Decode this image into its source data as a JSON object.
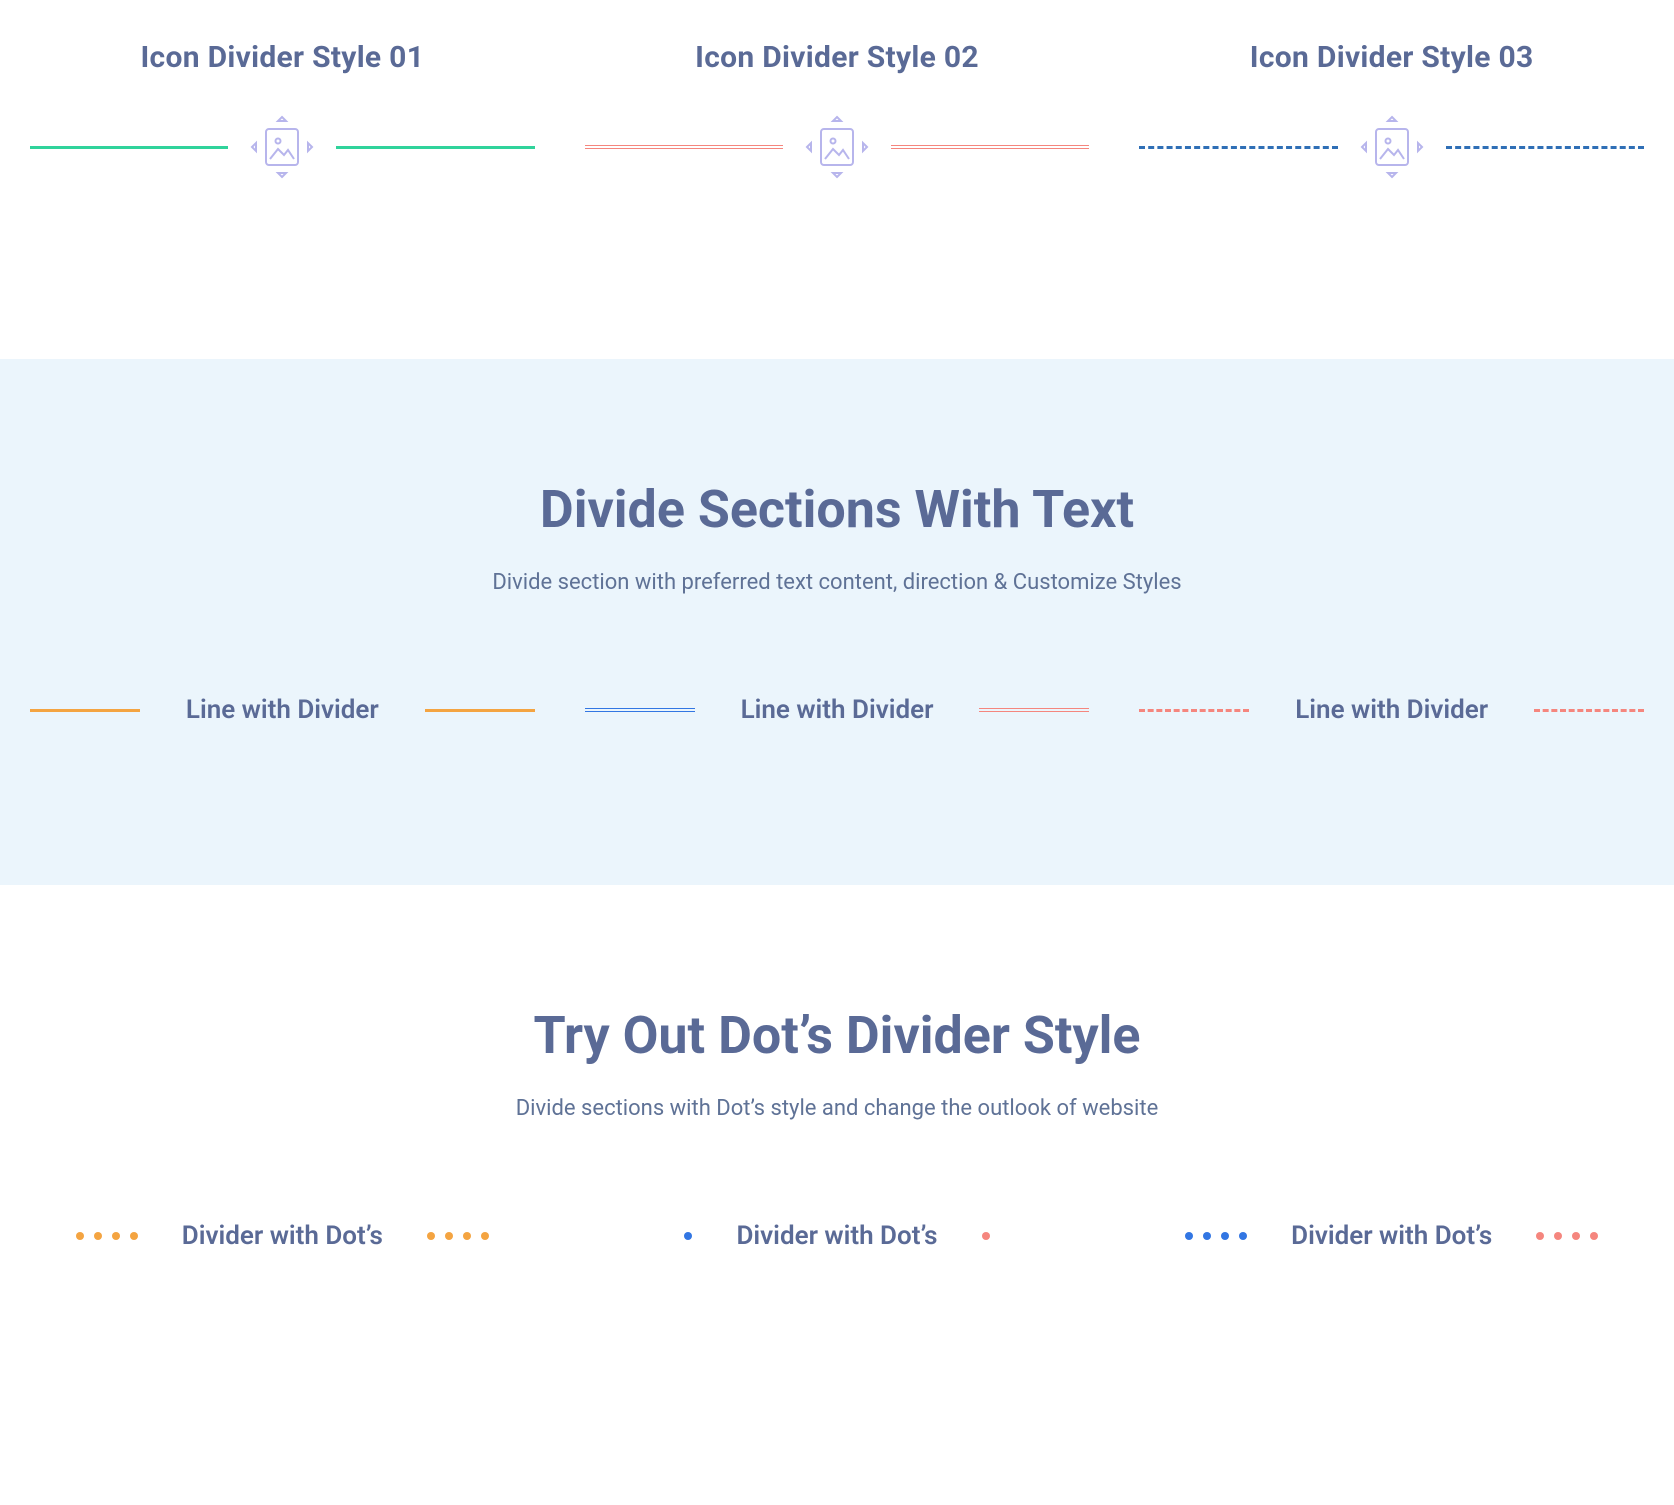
{
  "icon_section": {
    "cols": [
      {
        "title": "Icon Divider Style 01"
      },
      {
        "title": "Icon Divider Style 02"
      },
      {
        "title": "Icon Divider Style 03"
      }
    ]
  },
  "text_section": {
    "title": "Divide Sections With Text",
    "subtitle": "Divide section with preferred text content, direction & Customize Styles",
    "items": [
      {
        "label": "Line with Divider"
      },
      {
        "label": "Line with Divider"
      },
      {
        "label": "Line with Divider"
      }
    ]
  },
  "dots_section": {
    "title": "Try Out Dot’s Divider Style",
    "subtitle": "Divide sections with Dot’s style and change the outlook of website",
    "items": [
      {
        "label": "Divider with Dot’s"
      },
      {
        "label": "Divider with Dot’s"
      },
      {
        "label": "Divider with Dot’s"
      }
    ]
  }
}
